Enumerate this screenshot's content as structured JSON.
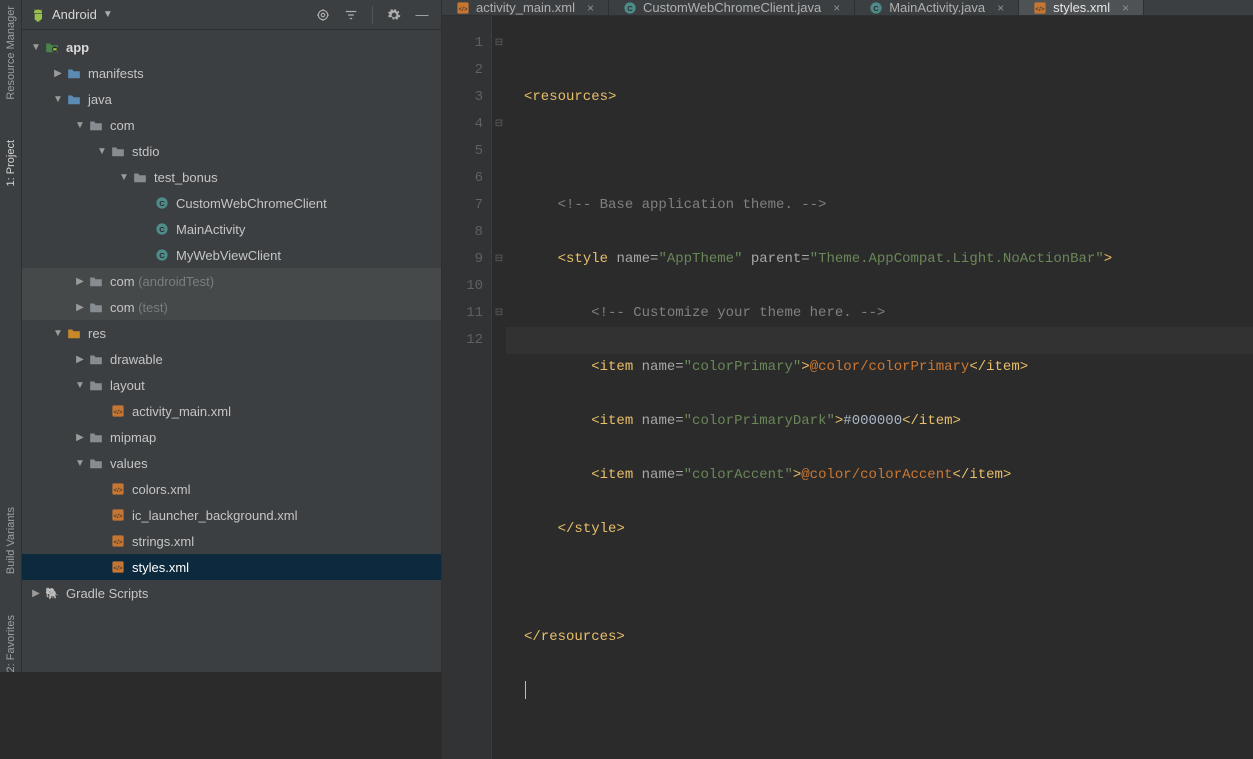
{
  "leftStrip": {
    "labels": [
      "Resource Manager",
      "1: Project",
      "Build Variants",
      "2: Favorites"
    ]
  },
  "sidePanel": {
    "title": "Android",
    "tree": {
      "app": "app",
      "manifests": "manifests",
      "java": "java",
      "com1": "com",
      "stdio": "stdio",
      "test_bonus": "test_bonus",
      "cls1": "CustomWebChromeClient",
      "cls2": "MainActivity",
      "cls3": "MyWebViewClient",
      "com2": "com",
      "com2s": "(androidTest)",
      "com3": "com",
      "com3s": "(test)",
      "res": "res",
      "drawable": "drawable",
      "layout": "layout",
      "act_main": "activity_main.xml",
      "mipmap": "mipmap",
      "values": "values",
      "colors": "colors.xml",
      "ic_launcher": "ic_launcher_background.xml",
      "strings": "strings.xml",
      "styles": "styles.xml",
      "gradle": "Gradle Scripts"
    }
  },
  "tabs": [
    {
      "label": "activity_main.xml",
      "icon": "xml",
      "active": false
    },
    {
      "label": "CustomWebChromeClient.java",
      "icon": "java",
      "active": false
    },
    {
      "label": "MainActivity.java",
      "icon": "java",
      "active": false
    },
    {
      "label": "styles.xml",
      "icon": "xml",
      "active": true
    }
  ],
  "gutter": [
    "1",
    "2",
    "3",
    "4",
    "5",
    "6",
    "7",
    "8",
    "9",
    "10",
    "11",
    "12"
  ],
  "code": {
    "l1a": "<resources>",
    "l3a": "<!-- Base application theme. -->",
    "l4a": "<style",
    "l4b": "name=",
    "l4c": "\"AppTheme\"",
    "l4d": "parent=",
    "l4e": "\"Theme.AppCompat.Light.NoActionBar\"",
    "l4f": ">",
    "l5a": "<!-- Customize your theme here. -->",
    "l6a": "<item",
    "l6b": "name=",
    "l6c": "\"colorPrimary\"",
    "l6d": ">",
    "l6e": "@color/colorPrimary",
    "l6f": "</item>",
    "l7a": "<item",
    "l7b": "name=",
    "l7c": "\"colorPrimaryDark\"",
    "l7d": ">",
    "l7e": "#000000",
    "l7f": "</item>",
    "l8a": "<item",
    "l8b": "name=",
    "l8c": "\"colorAccent\"",
    "l8d": ">",
    "l8e": "@color/colorAccent",
    "l8f": "</item>",
    "l9a": "</style>",
    "l11a": "</resources>"
  }
}
